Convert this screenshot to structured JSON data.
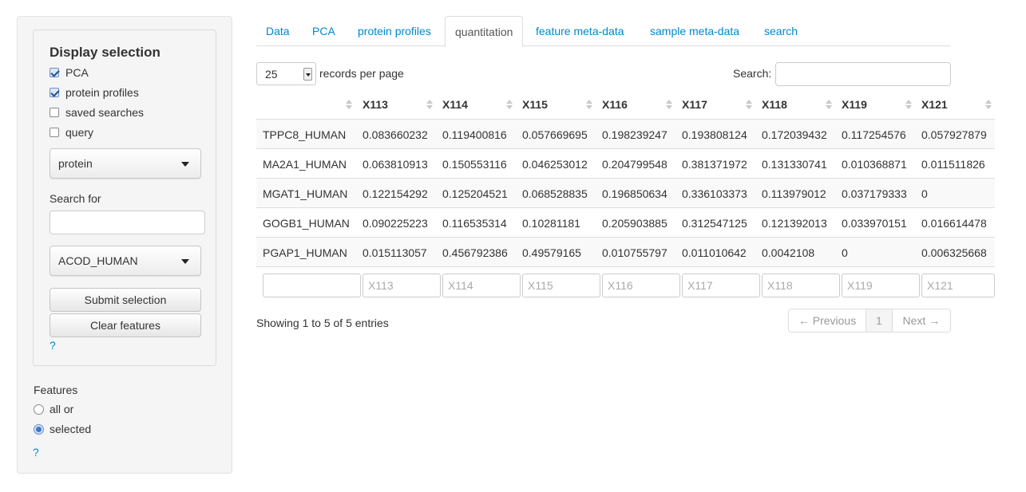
{
  "sidebar": {
    "title": "Display selection",
    "checkboxes": [
      {
        "label": "PCA",
        "checked": true
      },
      {
        "label": "protein profiles",
        "checked": true
      },
      {
        "label": "saved searches",
        "checked": false
      },
      {
        "label": "query",
        "checked": false
      }
    ],
    "type_select": "protein",
    "search_for_label": "Search for",
    "search_for_value": "",
    "feature_select": "ACOD_HUMAN",
    "submit_label": "Submit selection",
    "clear_label": "Clear features",
    "help1": "?",
    "features_label": "Features",
    "radios": [
      {
        "label": "all or",
        "checked": false
      },
      {
        "label": "selected",
        "checked": true
      }
    ],
    "help2": "?"
  },
  "tabs": [
    {
      "label": "Data",
      "active": false
    },
    {
      "label": "PCA",
      "active": false
    },
    {
      "label": "protein profiles",
      "active": false
    },
    {
      "label": "quantitation",
      "active": true
    },
    {
      "label": "feature meta-data",
      "active": false
    },
    {
      "label": "sample meta-data",
      "active": false
    },
    {
      "label": "search",
      "active": false
    }
  ],
  "table_controls": {
    "page_length": "25",
    "page_length_label": "records per page",
    "search_label": "Search:",
    "search_value": ""
  },
  "table": {
    "columns": [
      "",
      "X113",
      "X114",
      "X115",
      "X116",
      "X117",
      "X118",
      "X119",
      "X121"
    ],
    "rows": [
      [
        "TPPC8_HUMAN",
        "0.083660232",
        "0.119400816",
        "0.057669695",
        "0.198239247",
        "0.193808124",
        "0.172039432",
        "0.117254576",
        "0.057927879"
      ],
      [
        "MA2A1_HUMAN",
        "0.063810913",
        "0.150553116",
        "0.046253012",
        "0.204799548",
        "0.381371972",
        "0.131330741",
        "0.010368871",
        "0.011511826"
      ],
      [
        "MGAT1_HUMAN",
        "0.122154292",
        "0.125204521",
        "0.068528835",
        "0.196850634",
        "0.336103373",
        "0.113979012",
        "0.037179333",
        "0"
      ],
      [
        "GOGB1_HUMAN",
        "0.090225223",
        "0.116535314",
        "0.10281181",
        "0.205903885",
        "0.312547125",
        "0.121392013",
        "0.033970151",
        "0.016614478"
      ],
      [
        "PGAP1_HUMAN",
        "0.015113057",
        "0.456792386",
        "0.49579165",
        "0.010755797",
        "0.011010642",
        "0.0042108",
        "0",
        "0.006325668"
      ]
    ],
    "filter_placeholders": [
      "",
      "X113",
      "X114",
      "X115",
      "X116",
      "X117",
      "X118",
      "X119",
      "X121"
    ]
  },
  "footer": {
    "info": "Showing 1 to 5 of 5 entries",
    "previous": "← Previous",
    "page": "1",
    "next": "Next →"
  }
}
